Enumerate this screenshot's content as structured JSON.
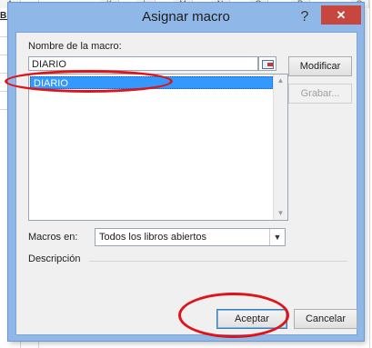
{
  "sheet": {
    "columns": [
      "A",
      "K",
      "L",
      "M",
      "N",
      "O",
      "P",
      "Q"
    ],
    "cell_text": "BER"
  },
  "dialog": {
    "title": "Asignar macro",
    "help_label": "?",
    "close_label": "✕",
    "name_label": "Nombre de la macro:",
    "name_value": "DIARIO",
    "list_items": [
      "DIARIO"
    ],
    "selected_index": 0,
    "buttons": {
      "modify": "Modificar",
      "record": "Grabar...",
      "ok": "Aceptar",
      "cancel": "Cancelar"
    },
    "macros_in_label": "Macros en:",
    "macros_in_value": "Todos los libros abiertos",
    "description_label": "Descripción"
  },
  "colors": {
    "dialog_frame": "#8fb8e8",
    "close_button": "#c7463e",
    "selection": "#3399ff",
    "annotation": "#e0121a"
  },
  "icons": [
    "help-icon",
    "close-icon",
    "range-select-icon",
    "scroll-up-icon",
    "scroll-down-icon",
    "chevron-down-icon"
  ]
}
